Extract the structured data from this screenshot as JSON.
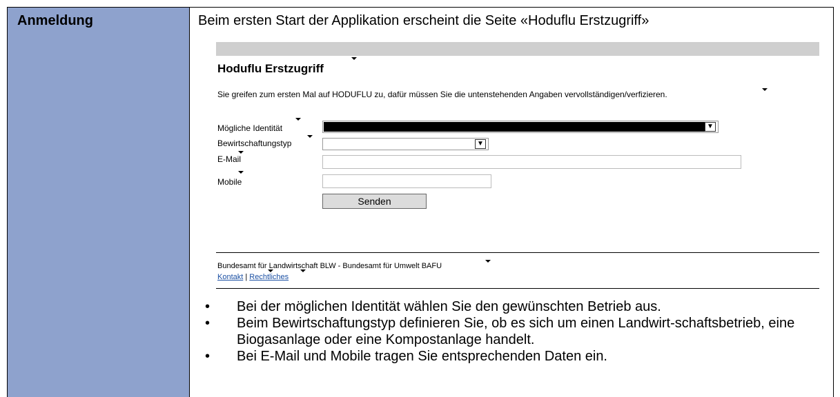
{
  "left_cell": {
    "label": "Anmeldung"
  },
  "intro_text": "Beim ersten Start der Applikation erscheint die Seite «Hoduflu Erstzugriff»",
  "screenshot": {
    "title": "Hoduflu Erstzugriff",
    "description": "Sie greifen zum ersten Mal auf HODUFLU zu, dafür müssen Sie die untenstehenden Angaben vervollständigen/verfizieren.",
    "fields": {
      "identity_label": "Mögliche Identität",
      "type_label": "Bewirtschaftungstyp",
      "email_label": "E-Mail",
      "mobile_label": "Mobile"
    },
    "submit_label": "Senden",
    "dropdown_arrow": "chevron-down-icon",
    "footer_text": "Bundesamt für Landwirtschaft BLW - Bundesamt für Umwelt BAFU",
    "links": {
      "contact": "Kontakt",
      "separator": "|",
      "legal": "Rechtliches"
    },
    "colors": {
      "topbar": "#cfcfcf",
      "link": "#1a4fa3"
    }
  },
  "bullets": [
    "Bei der möglichen Identität wählen Sie den gewünschten Betrieb aus.",
    "Beim Bewirtschaftungstyp definieren Sie, ob es sich um einen Landwirt-schaftsbetrieb, eine Biogasanlage oder eine Kompostanlage handelt.",
    "Bei E-Mail und Mobile tragen Sie entsprechenden Daten ein."
  ],
  "colors": {
    "left_cell_bg": "#8ea2cd"
  }
}
